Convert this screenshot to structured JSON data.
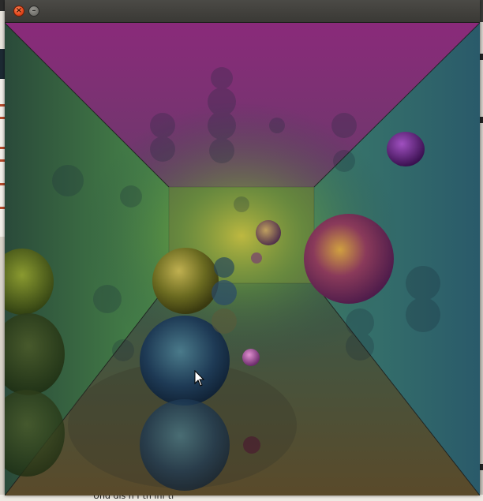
{
  "window": {
    "title": "",
    "close_glyph": "×",
    "minimize_glyph": "–"
  },
  "background": {
    "partial_text": "Und    dis    n   f  th    inf    ti"
  },
  "scene": {
    "description_icon": "raytraced-spheres-render",
    "spheres": [
      {
        "name": "gold-sphere",
        "color": "#8a8a2a"
      },
      {
        "name": "blue-sphere",
        "color": "#2a4a6a"
      },
      {
        "name": "magenta-sphere",
        "color": "#8a3a6a"
      },
      {
        "name": "purple-sphere",
        "color": "#6a2a8a"
      },
      {
        "name": "small-sphere",
        "color": "#7a6a5a"
      },
      {
        "name": "pink-sphere",
        "color": "#b060a0"
      },
      {
        "name": "left-green-sphere",
        "color": "#5a6a20"
      }
    ]
  },
  "cursor_icon": "arrow-pointer-icon"
}
